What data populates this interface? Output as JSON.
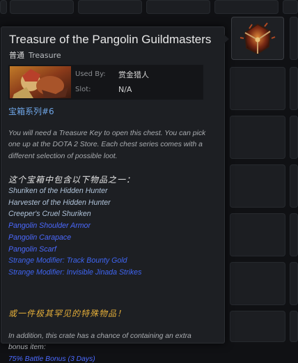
{
  "tooltip": {
    "title": "Treasure of the Pangolin Guildmasters",
    "quality": "普通",
    "type": "Treasure",
    "used_by_label": "Used By:",
    "used_by_value": "赏金猎人",
    "slot_label": "Slot:",
    "slot_value": "N/A",
    "series": "宝箱系列#6",
    "description": "You will need a Treasure Key to open this chest. You can pick one up at the DOTA 2 Store. Each chest series comes with a different selection of possible loot.",
    "contents_header": "这个宝箱中包含以下物品之一：",
    "loot": [
      {
        "name": "Shuriken of the Hidden Hunter",
        "rarity": "common"
      },
      {
        "name": "Harvester of the Hidden Hunter",
        "rarity": "common"
      },
      {
        "name": "Creeper's Cruel Shuriken",
        "rarity": "common"
      },
      {
        "name": "Pangolin Shoulder Armor",
        "rarity": "rare"
      },
      {
        "name": "Pangolin Carapace",
        "rarity": "rare"
      },
      {
        "name": "Pangolin Scarf",
        "rarity": "rare"
      },
      {
        "name": "Strange Modifier: Track Bounty Gold",
        "rarity": "strange"
      },
      {
        "name": "Strange Modifier: Invisible Jinada Strikes",
        "rarity": "strange"
      }
    ],
    "rare_line": "或一件极其罕见的特殊物品！",
    "bonus_description": "In addition, this crate has a chance of containing an extra bonus item:",
    "bonus_item": "75% Battle Bonus (3 Days)"
  },
  "colors": {
    "common": "#b0c3d9",
    "rare": "#4b69ff",
    "strange": "#3f65f2",
    "series": "#6fa6e8",
    "gold": "#e4ae39"
  },
  "icons": {
    "hero_thumbnail": "bounty-hunter-portrait",
    "chest": "treasure-chest-icon"
  }
}
